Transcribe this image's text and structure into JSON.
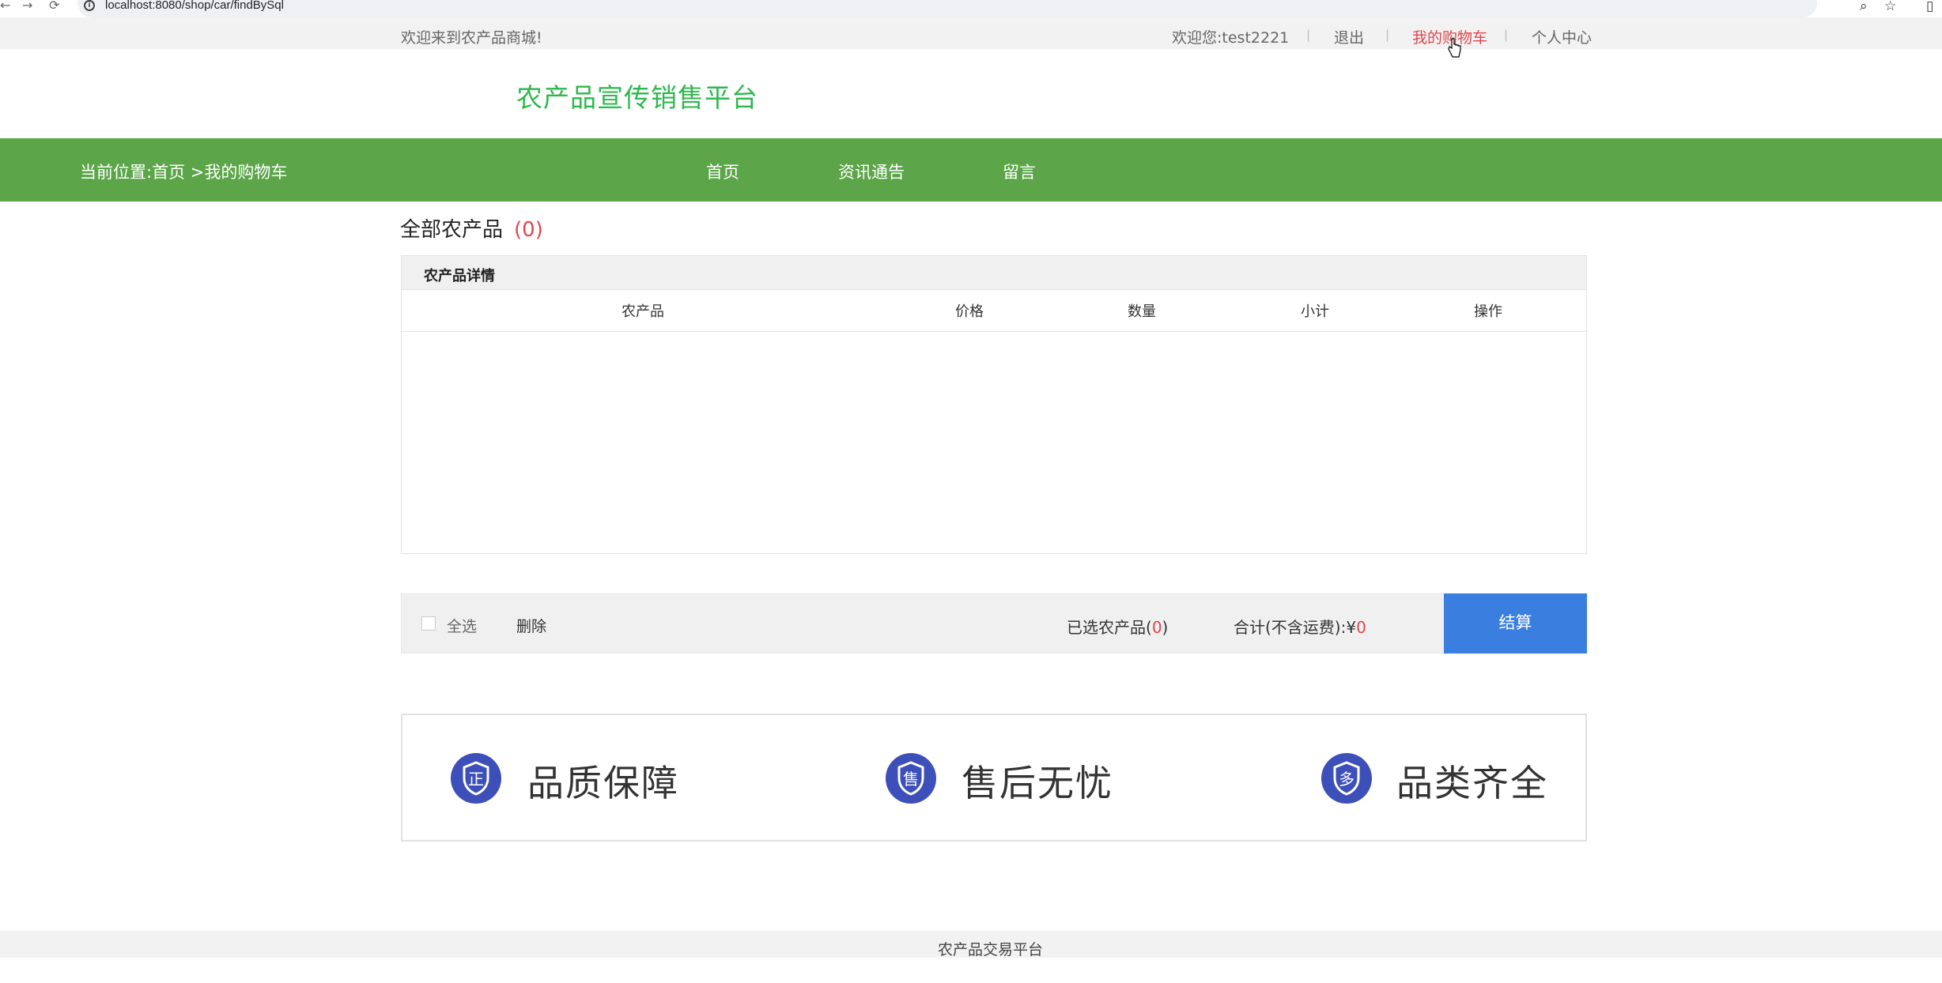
{
  "browser": {
    "url": "localhost:8080/shop/car/findBySql"
  },
  "top": {
    "welcome": "欢迎来到农产品商城!",
    "user_greeting": "欢迎您:test2221",
    "logout": "退出",
    "cart": "我的购物车",
    "profile": "个人中心"
  },
  "logo": {
    "title": "农产品宣传销售平台"
  },
  "nav": {
    "breadcrumb": "当前位置:首页 >我的购物车",
    "items": [
      "首页",
      "资讯通告",
      "留言"
    ]
  },
  "cart": {
    "title": "全部农产品",
    "count": "(0)",
    "caption": "农产品详情",
    "columns": [
      "农产品",
      "价格",
      "数量",
      "小计",
      "操作"
    ]
  },
  "summary": {
    "select_all": "全选",
    "delete": "删除",
    "selected_prefix": "已选农产品(",
    "selected_count": "0",
    "selected_suffix": ")",
    "total_prefix": "合计(不含运费):¥",
    "total_value": "0",
    "checkout": "结算"
  },
  "guarantees": [
    {
      "label": "品质保障",
      "glyph": "正",
      "icon": "quality-icon"
    },
    {
      "label": "售后无忧",
      "glyph": "售",
      "icon": "after-sales-icon"
    },
    {
      "label": "品类齐全",
      "glyph": "多",
      "icon": "variety-icon"
    }
  ],
  "footer": {
    "text": "农产品交易平台"
  },
  "colors": {
    "nav_green": "#5ca549",
    "logo_green": "#2db84d",
    "accent_red": "#e0474c",
    "checkout_blue": "#3a7fe0",
    "icon_indigo": "#3d4fb8"
  }
}
